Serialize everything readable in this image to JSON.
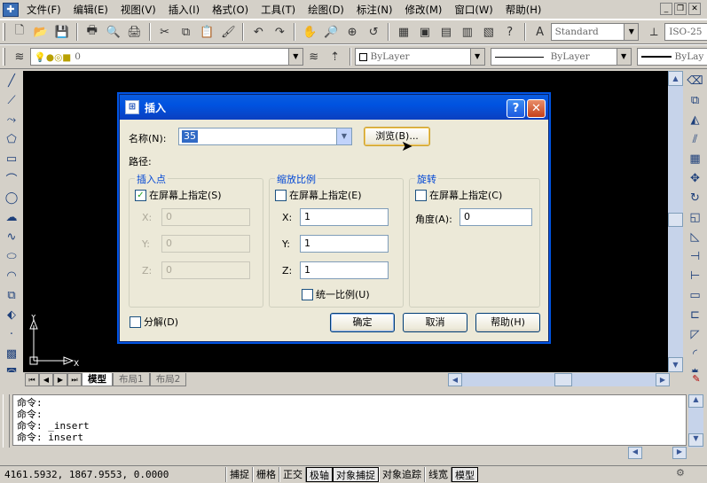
{
  "menu": {
    "items": [
      "文件(F)",
      "编辑(E)",
      "视图(V)",
      "插入(I)",
      "格式(O)",
      "工具(T)",
      "绘图(D)",
      "标注(N)",
      "修改(M)",
      "窗口(W)",
      "帮助(H)"
    ]
  },
  "toolbar": {
    "text_style": "Standard",
    "dim_style": "ISO-25",
    "layer": "0",
    "color": "ByLayer",
    "linetype": "ByLayer",
    "lineweight": "ByLay"
  },
  "layout_tabs": [
    "模型",
    "布局1",
    "布局2"
  ],
  "ucs": {
    "y_label": "Y",
    "x_label": "X"
  },
  "command_lines": [
    "命令:",
    "命令:",
    "命令: _insert",
    "命令: insert"
  ],
  "status": {
    "coords": "4161.5932,  1867.9553, 0.0000",
    "toggles": [
      "捕捉",
      "栅格",
      "正交",
      "极轴",
      "对象捕捉",
      "对象追踪",
      "线宽",
      "模型"
    ],
    "on": [
      false,
      false,
      false,
      true,
      true,
      false,
      false,
      true
    ]
  },
  "dialog": {
    "title": "插入",
    "name_label": "名称(N):",
    "name_value": "35",
    "browse_label": "浏览(B)...",
    "path_label": "路径:",
    "insertion": {
      "title": "插入点",
      "specify_label": "在屏幕上指定(S)",
      "specify_checked": true,
      "x_label": "X:",
      "y_label": "Y:",
      "z_label": "Z:",
      "x": "0",
      "y": "0",
      "z": "0"
    },
    "scale": {
      "title": "缩放比例",
      "specify_label": "在屏幕上指定(E)",
      "specify_checked": false,
      "x_label": "X:",
      "y_label": "Y:",
      "z_label": "Z:",
      "x": "1",
      "y": "1",
      "z": "1",
      "uniform_label": "统一比例(U)"
    },
    "rotation": {
      "title": "旋转",
      "specify_label": "在屏幕上指定(C)",
      "specify_checked": false,
      "angle_label": "角度(A):",
      "angle": "0"
    },
    "explode_label": "分解(D)",
    "ok_label": "确定",
    "cancel_label": "取消",
    "help_label": "帮助(H)"
  }
}
